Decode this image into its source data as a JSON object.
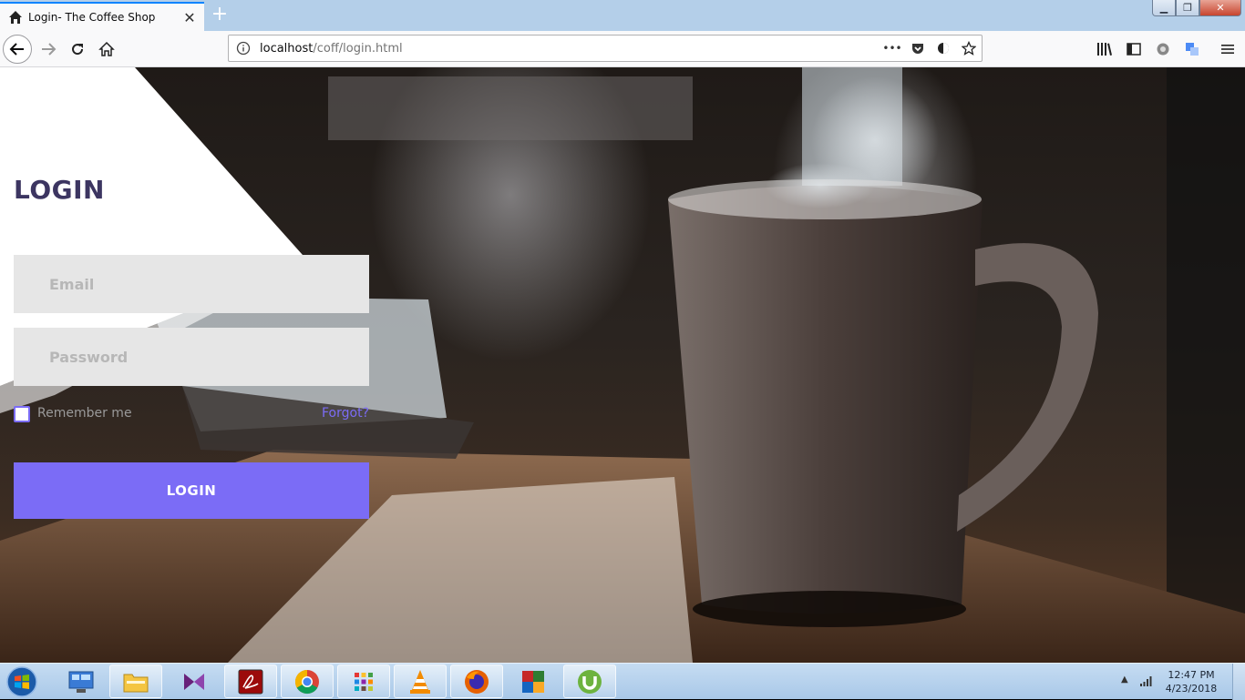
{
  "browser": {
    "tab_title": "Login- The Coffee Shop",
    "tab_close": "✕",
    "new_tab": "+",
    "url_host": "localhost",
    "url_path": "/coff/login.html",
    "page_actions": "•••"
  },
  "login": {
    "heading": "LOGIN",
    "email_placeholder": "Email",
    "password_placeholder": "Password",
    "remember_label": "Remember me",
    "forgot_label": "Forgot?",
    "submit_label": "LOGIN",
    "accent_color": "#7b6cf6",
    "heading_color": "#3c3561"
  },
  "taskbar": {
    "time": "12:47 PM",
    "date": "4/23/2018",
    "apps": [
      "windows-explorer-library",
      "file-explorer",
      "visual-studio",
      "acrobat-reader",
      "chrome",
      "app-grid",
      "vlc",
      "firefox",
      "winrar",
      "utorrent"
    ]
  }
}
